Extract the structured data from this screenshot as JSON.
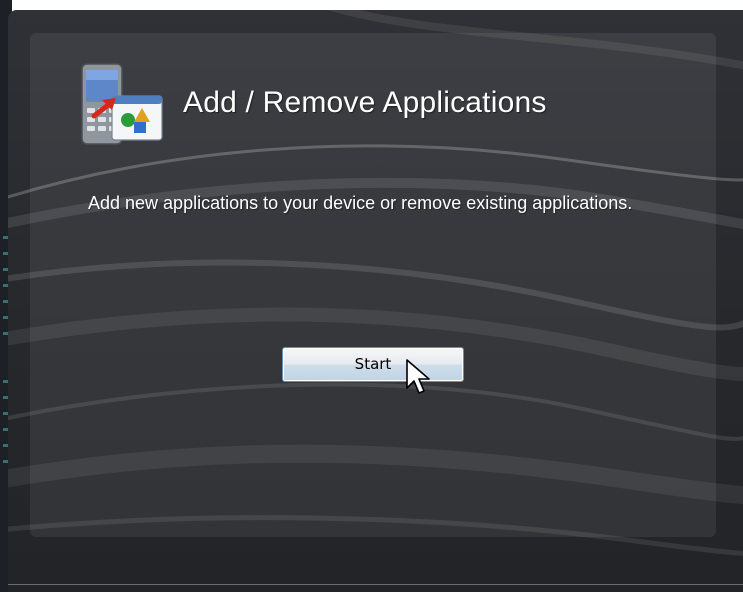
{
  "dialog": {
    "title": "Add / Remove Applications",
    "description": "Add new applications to your device or remove existing applications.",
    "start_label": "Start",
    "app_icon": "device-applications-icon"
  },
  "cursor": {
    "icon": "mouse-pointer-icon"
  },
  "colors": {
    "background_dark": "#26282c",
    "panel_tint": "#3a3c40",
    "text": "#ffffff",
    "button_border": "#6a8fb0",
    "button_face": "#e6ebf0"
  }
}
